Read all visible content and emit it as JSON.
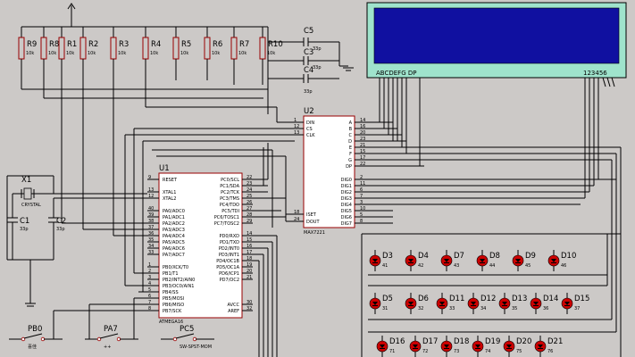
{
  "resistors": [
    {
      "ref": "R9",
      "value": "10k"
    },
    {
      "ref": "R8",
      "value": "10k"
    },
    {
      "ref": "R1",
      "value": "10k"
    },
    {
      "ref": "R2",
      "value": "10k"
    },
    {
      "ref": "R3",
      "value": "10k"
    },
    {
      "ref": "R4",
      "value": "10k"
    },
    {
      "ref": "R5",
      "value": "10k"
    },
    {
      "ref": "R6",
      "value": "10k"
    },
    {
      "ref": "R7",
      "value": "10k"
    },
    {
      "ref": "R10",
      "value": "10k"
    }
  ],
  "caps": {
    "c5": {
      "ref": "C5",
      "value": "33p"
    },
    "c3": {
      "ref": "C3",
      "value": "33p"
    },
    "c4": {
      "ref": "C4",
      "value": "33p"
    },
    "c1": {
      "ref": "C1",
      "value": "33p"
    },
    "c2": {
      "ref": "C2",
      "value": "33p"
    }
  },
  "crystal": {
    "ref": "X1",
    "type": "CRYSTAL"
  },
  "lcd": {
    "segments": "ABCDEFG DP",
    "digits": "123456"
  },
  "u2": {
    "ref": "U2",
    "part": "MAX7221",
    "left_pins": [
      {
        "num": "1",
        "name": "DIN"
      },
      {
        "num": "12",
        "name": "CS"
      },
      {
        "num": "13",
        "name": "CLK"
      },
      {
        "num": "18",
        "name": "ISET"
      },
      {
        "num": "24",
        "name": "DOUT"
      }
    ],
    "seg_pins": [
      {
        "name": "A",
        "num": "14"
      },
      {
        "name": "B",
        "num": "16"
      },
      {
        "name": "C",
        "num": "20"
      },
      {
        "name": "D",
        "num": "23"
      },
      {
        "name": "E",
        "num": "21"
      },
      {
        "name": "F",
        "num": "15"
      },
      {
        "name": "G",
        "num": "17"
      },
      {
        "name": "DP",
        "num": "22"
      }
    ],
    "dig_pins": [
      {
        "name": "DIG0",
        "num": "2"
      },
      {
        "name": "DIG1",
        "num": "11"
      },
      {
        "name": "DIG2",
        "num": "6"
      },
      {
        "name": "DIG3",
        "num": "7"
      },
      {
        "name": "DIG4",
        "num": "3"
      },
      {
        "name": "DIG5",
        "num": "10"
      },
      {
        "name": "DIG6",
        "num": "5"
      },
      {
        "name": "DIG7",
        "num": "8"
      }
    ]
  },
  "u1": {
    "ref": "U1",
    "part": "ATMEGA16",
    "left_pins": [
      {
        "num": "9",
        "name": "RESET"
      },
      {
        "num": "13",
        "name": "XTAL1"
      },
      {
        "num": "12",
        "name": "XTAL2"
      },
      {
        "num": "40",
        "name": "PA0/ADC0"
      },
      {
        "num": "39",
        "name": "PA1/ADC1"
      },
      {
        "num": "38",
        "name": "PA2/ADC2"
      },
      {
        "num": "37",
        "name": "PA3/ADC3"
      },
      {
        "num": "36",
        "name": "PA4/ADC4"
      },
      {
        "num": "35",
        "name": "PA5/ADC5"
      },
      {
        "num": "34",
        "name": "PA6/ADC6"
      },
      {
        "num": "33",
        "name": "PA7/ADC7"
      },
      {
        "num": "1",
        "name": "PB0/XCK/T0"
      },
      {
        "num": "2",
        "name": "PB1/T1"
      },
      {
        "num": "3",
        "name": "PB2/INT2/AIN0"
      },
      {
        "num": "4",
        "name": "PB3/OC0/AIN1"
      },
      {
        "num": "5",
        "name": "PB4/SS"
      },
      {
        "num": "6",
        "name": "PB5/MOSI"
      },
      {
        "num": "7",
        "name": "PB6/MISO"
      },
      {
        "num": "8",
        "name": "PB7/SCK"
      }
    ],
    "right_pins": [
      {
        "name": "PC0/SCL",
        "num": "22"
      },
      {
        "name": "PC1/SDA",
        "num": "23"
      },
      {
        "name": "PC2/TCK",
        "num": "24"
      },
      {
        "name": "PC3/TMS",
        "num": "25"
      },
      {
        "name": "PC4/TDO",
        "num": "26"
      },
      {
        "name": "PC5/TDI",
        "num": "27"
      },
      {
        "name": "PC6/TOSC1",
        "num": "28"
      },
      {
        "name": "PC7/TOSC2",
        "num": "29"
      },
      {
        "name": "PD0/RXD",
        "num": "14"
      },
      {
        "name": "PD1/TXD",
        "num": "15"
      },
      {
        "name": "PD2/INT0",
        "num": "16"
      },
      {
        "name": "PD3/INT1",
        "num": "17"
      },
      {
        "name": "PD4/OC1B",
        "num": "18"
      },
      {
        "name": "PD5/OC1A",
        "num": "19"
      },
      {
        "name": "PD6/ICP1",
        "num": "20"
      },
      {
        "name": "PD7/OC2",
        "num": "21"
      },
      {
        "name": "AVCC",
        "num": "30"
      },
      {
        "name": "AREF",
        "num": "32"
      }
    ]
  },
  "leds": [
    {
      "ref": "D3",
      "num": "41"
    },
    {
      "ref": "D4",
      "num": "42"
    },
    {
      "ref": "D7",
      "num": "43"
    },
    {
      "ref": "D8",
      "num": "44"
    },
    {
      "ref": "D9",
      "num": "45"
    },
    {
      "ref": "D10",
      "num": "46"
    },
    {
      "ref": "D5",
      "num": "31"
    },
    {
      "ref": "D6",
      "num": "32"
    },
    {
      "ref": "D11",
      "num": "33"
    },
    {
      "ref": "D12",
      "num": "34"
    },
    {
      "ref": "D13",
      "num": "35"
    },
    {
      "ref": "D14",
      "num": "36"
    },
    {
      "ref": "D15",
      "num": "37"
    },
    {
      "ref": "D16",
      "num": "71"
    },
    {
      "ref": "D17",
      "num": "72"
    },
    {
      "ref": "D18",
      "num": "73"
    },
    {
      "ref": "D19",
      "num": "74"
    },
    {
      "ref": "D20",
      "num": "75"
    },
    {
      "ref": "D21",
      "num": "76"
    }
  ],
  "switches": [
    {
      "ref": "PB0",
      "sub": "喜佳"
    },
    {
      "ref": "PA7",
      "sub": "++"
    },
    {
      "ref": "PC5",
      "sub": "SW-SPST-MOM"
    }
  ]
}
